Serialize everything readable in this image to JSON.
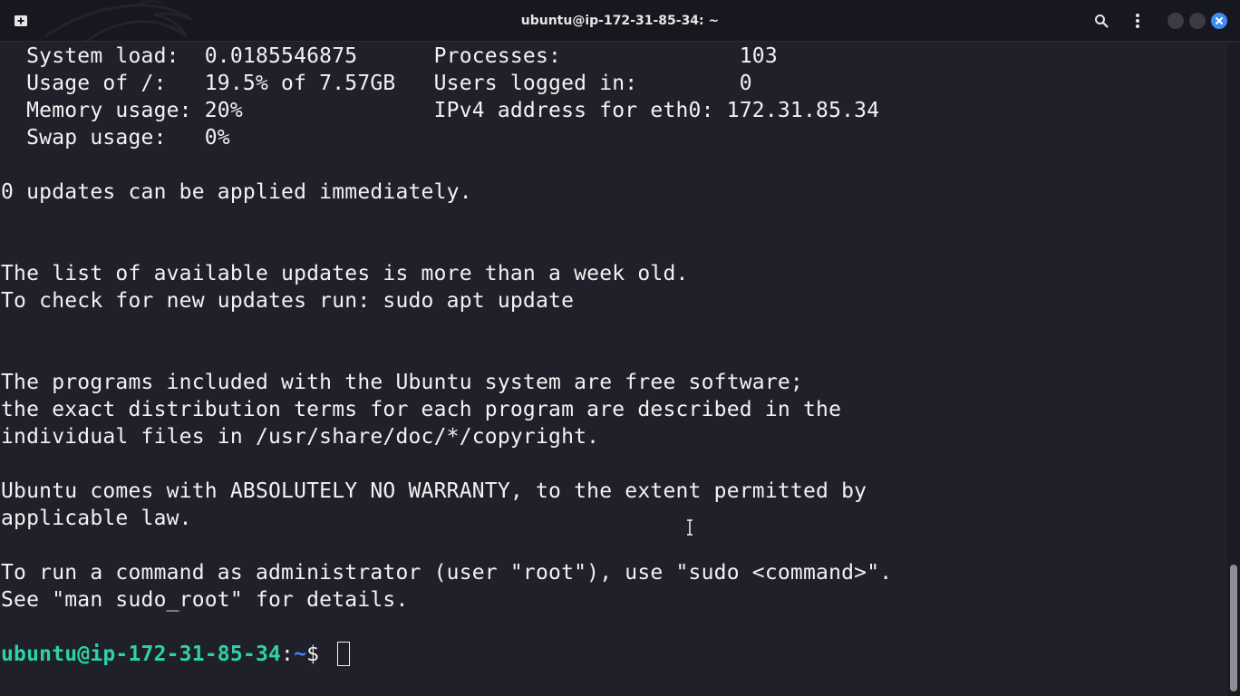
{
  "window": {
    "title": "ubuntu@ip-172-31-85-34: ~",
    "icons": {
      "new_tab": "new-tab-icon",
      "search": "search-icon",
      "menu": "kebab-menu-icon",
      "minimize": "minimize-icon",
      "maximize": "maximize-icon",
      "close": "close-icon"
    },
    "colors": {
      "background": "#1f202a",
      "titlebar": "#16171f",
      "text": "#f2f2f2",
      "prompt_user": "#2bd3a7",
      "prompt_path": "#3d8bf5",
      "close_button": "#3d8bf5"
    }
  },
  "terminal": {
    "lines": [
      "  System load:  0.0185546875      Processes:              103",
      "  Usage of /:   19.5% of 7.57GB   Users logged in:        0",
      "  Memory usage: 20%               IPv4 address for eth0: 172.31.85.34",
      "  Swap usage:   0%",
      "",
      "0 updates can be applied immediately.",
      "",
      "",
      "The list of available updates is more than a week old.",
      "To check for new updates run: sudo apt update",
      "",
      "",
      "The programs included with the Ubuntu system are free software;",
      "the exact distribution terms for each program are described in the",
      "individual files in /usr/share/doc/*/copyright.",
      "",
      "Ubuntu comes with ABSOLUTELY NO WARRANTY, to the extent permitted by",
      "applicable law.",
      "",
      "To run a command as administrator (user \"root\"), use \"sudo <command>\".",
      "See \"man sudo_root\" for details.",
      ""
    ],
    "prompt": {
      "user_host": "ubuntu@ip-172-31-85-34",
      "separator": ":",
      "path": "~",
      "symbol": "$ "
    }
  }
}
